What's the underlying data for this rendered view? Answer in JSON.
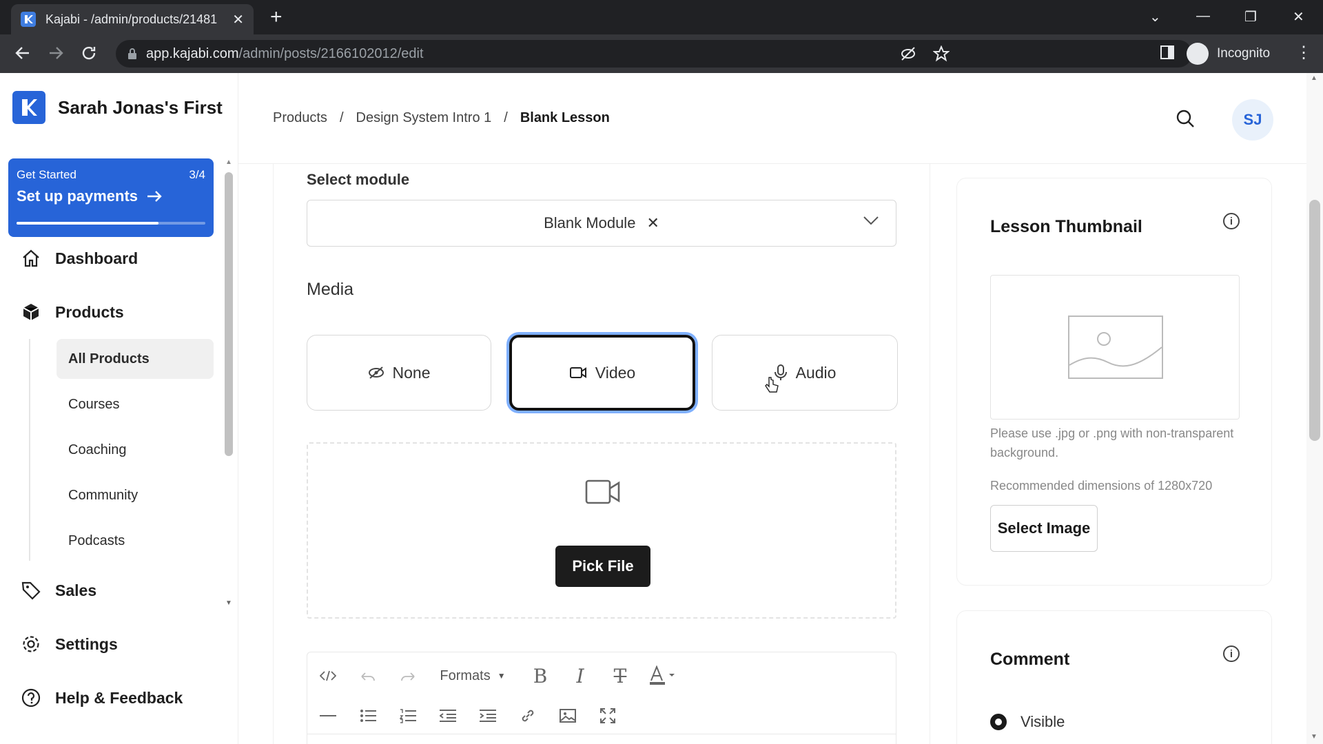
{
  "browser": {
    "tab_title": "Kabi - /admin/products/21481",
    "tab_title_full": "Kajabi - /admin/products/21481",
    "url_host": "app.kajabi.com",
    "url_path": "/admin/posts/2166102012/edit",
    "incognito_label": "Incognito"
  },
  "sidebar": {
    "brand": "Sarah Jonas's First",
    "get_started": {
      "label": "Get Started",
      "progress_text": "3/4",
      "action": "Set up payments",
      "progress": 0.75
    },
    "nav": {
      "dashboard": "Dashboard",
      "products": "Products",
      "sales": "Sales",
      "settings": "Settings",
      "help": "Help & Feedback"
    },
    "sub": [
      "All Products",
      "Courses",
      "Coaching",
      "Community",
      "Podcasts"
    ]
  },
  "header": {
    "breadcrumb": [
      "Products",
      "Design System Intro 1",
      "Blank Lesson"
    ],
    "separator": "/",
    "avatar_initials": "SJ"
  },
  "main": {
    "select_module_label": "Select module",
    "module_value": "Blank Module",
    "media_heading": "Media",
    "media_options": [
      "None",
      "Video",
      "Audio"
    ],
    "media_selected": "Video",
    "pick_file": "Pick File",
    "editor": {
      "formats_label": "Formats"
    }
  },
  "thumbnail": {
    "title": "Lesson Thumbnail",
    "hint1": "Please use .jpg or .png with non-transparent background.",
    "hint2": "Recommended dimensions of 1280x720",
    "button": "Select Image"
  },
  "comment": {
    "title": "Comment",
    "option": "Visible"
  },
  "colors": {
    "brand": "#2764d8",
    "selected_ring": "#7fb0ff"
  }
}
